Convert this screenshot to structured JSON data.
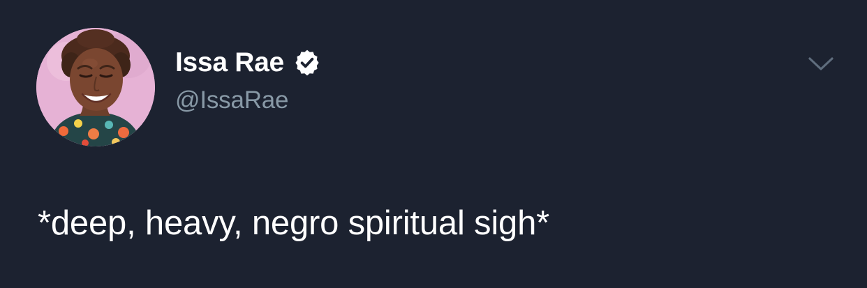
{
  "tweet": {
    "author": {
      "display_name": "Issa Rae",
      "handle": "@IssaRae",
      "verified": true,
      "avatar_icon": "profile-photo"
    },
    "text": "*deep, heavy, negro spiritual sigh*",
    "menu_icon": "chevron-down-icon",
    "colors": {
      "background": "#1c2230",
      "name": "#ffffff",
      "handle": "#8899a6",
      "verified_badge": "#ffffff",
      "chevron": "#5f6d7d"
    }
  }
}
